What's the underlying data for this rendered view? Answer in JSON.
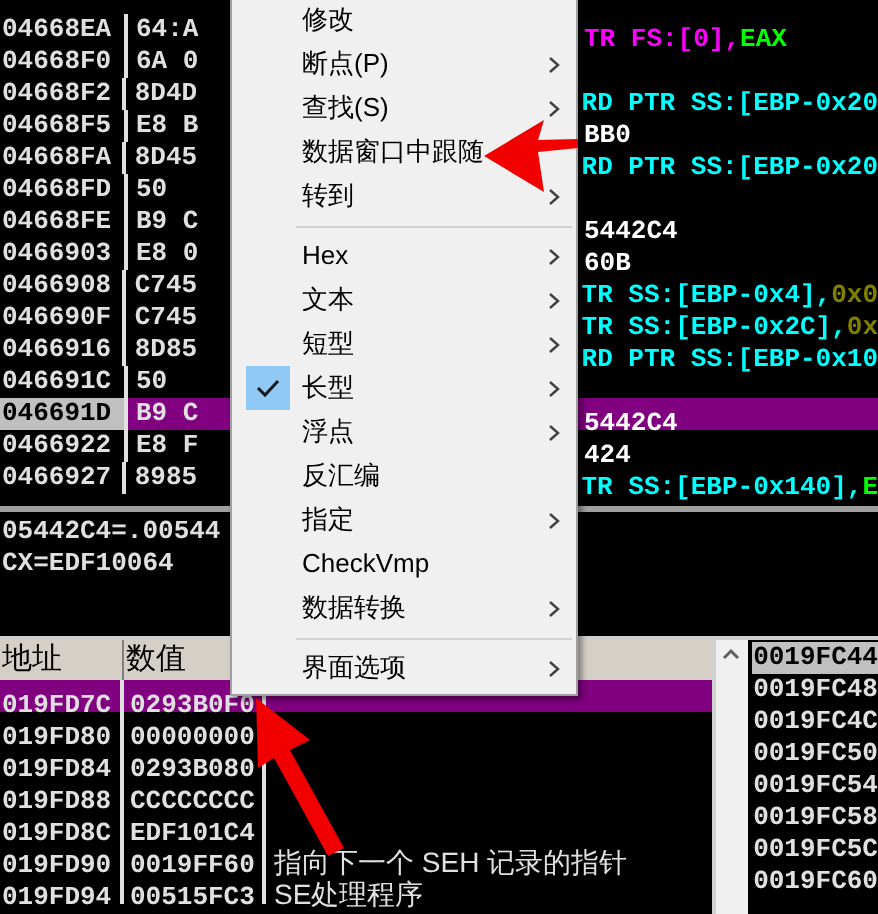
{
  "disassembly": {
    "rows": [
      {
        "address": "04668EA",
        "bytes": "64:A",
        "selected": false,
        "operand": [
          {
            "text": "TR FS:[",
            "color": "#ff00ff"
          },
          {
            "text": "0",
            "color": "#ff00ff"
          },
          {
            "text": "],",
            "color": "#ff00ff"
          },
          {
            "text": "EAX",
            "color": "#00ff00"
          }
        ]
      },
      {
        "address": "04668F0",
        "bytes": "6A 0",
        "selected": false,
        "operand": []
      },
      {
        "address": "04668F2",
        "bytes": "8D4D",
        "selected": false,
        "operand": [
          {
            "text": "RD PTR SS:[EBP-0x20",
            "color": "#00ffff"
          }
        ]
      },
      {
        "address": "04668F5",
        "bytes": "E8 B",
        "selected": false,
        "operand": [
          {
            "text": "BB0",
            "color": "#ffffff"
          }
        ]
      },
      {
        "address": "04668FA",
        "bytes": "8D45",
        "selected": false,
        "operand": [
          {
            "text": "RD PTR SS:[EBP-0x20",
            "color": "#00ffff"
          }
        ]
      },
      {
        "address": "04668FD",
        "bytes": "50",
        "selected": false,
        "operand": []
      },
      {
        "address": "04668FE",
        "bytes": "B9 C",
        "selected": false,
        "operand": [
          {
            "text": "5442C4",
            "color": "#ffffff"
          }
        ]
      },
      {
        "address": "0466903",
        "bytes": "E8 0",
        "selected": false,
        "operand": [
          {
            "text": "60B",
            "color": "#ffffff"
          }
        ]
      },
      {
        "address": "0466908",
        "bytes": "C745",
        "selected": false,
        "operand": [
          {
            "text": "TR SS:[EBP-0x4],",
            "color": "#00ffff"
          },
          {
            "text": "0x0",
            "color": "#808000"
          }
        ]
      },
      {
        "address": "046690F",
        "bytes": "C745",
        "selected": false,
        "operand": [
          {
            "text": "TR SS:[EBP-0x2C],",
            "color": "#00ffff"
          },
          {
            "text": "0x",
            "color": "#808000"
          }
        ]
      },
      {
        "address": "0466916",
        "bytes": "8D85",
        "selected": false,
        "operand": [
          {
            "text": "RD PTR SS:[EBP-0x10",
            "color": "#00ffff"
          }
        ]
      },
      {
        "address": "046691C",
        "bytes": "50",
        "selected": false,
        "operand": []
      },
      {
        "address": "046691D",
        "bytes": "B9 C",
        "selected": true,
        "operand": [
          {
            "text": "5442C4",
            "color": "#ffffff"
          }
        ]
      },
      {
        "address": "0466922",
        "bytes": "E8 F",
        "selected": false,
        "operand": [
          {
            "text": "424",
            "color": "#ffffff"
          }
        ]
      },
      {
        "address": "0466927",
        "bytes": "8985",
        "selected": false,
        "operand": [
          {
            "text": "TR SS:[EBP-0x140],",
            "color": "#00ffff"
          },
          {
            "text": "E",
            "color": "#00ff00"
          }
        ]
      }
    ]
  },
  "info": [
    "05442C4=.00544",
    "CX=EDF10064"
  ],
  "stack": {
    "columns": [
      "地址",
      "数值"
    ],
    "rows": [
      {
        "address": "019FD7C",
        "value": "0293B0F0",
        "comment": "",
        "selected": true
      },
      {
        "address": "019FD80",
        "value": "00000000",
        "comment": "",
        "selected": false
      },
      {
        "address": "019FD84",
        "value": "0293B080",
        "comment": "",
        "selected": false
      },
      {
        "address": "019FD88",
        "value": "CCCCCCCC",
        "comment": "",
        "selected": false
      },
      {
        "address": "019FD8C",
        "value": "EDF101C4",
        "comment": "",
        "selected": false
      },
      {
        "address": "019FD90",
        "value": "0019FF60",
        "comment": "指向下一个 SEH 记录的指针",
        "selected": false
      },
      {
        "address": "019FD94",
        "value": "00515FC3",
        "comment": "SE处理程序",
        "selected": false
      }
    ]
  },
  "side_stack": [
    {
      "address": "0019FC44",
      "selected": true
    },
    {
      "address": "0019FC48",
      "selected": false
    },
    {
      "address": "0019FC4C",
      "selected": false
    },
    {
      "address": "0019FC50",
      "selected": false
    },
    {
      "address": "0019FC54",
      "selected": false
    },
    {
      "address": "0019FC58",
      "selected": false
    },
    {
      "address": "0019FC5C",
      "selected": false
    },
    {
      "address": "0019FC60",
      "selected": false
    }
  ],
  "context_menu": {
    "groups": [
      [
        {
          "label": "修改",
          "submenu": false,
          "checked": false
        },
        {
          "label": "断点(P)",
          "submenu": true,
          "checked": false
        },
        {
          "label": "查找(S)",
          "submenu": true,
          "checked": false
        },
        {
          "label": "数据窗口中跟随",
          "submenu": false,
          "checked": false
        },
        {
          "label": "转到",
          "submenu": true,
          "checked": false
        }
      ],
      [
        {
          "label": "Hex",
          "submenu": true,
          "checked": false
        },
        {
          "label": "文本",
          "submenu": true,
          "checked": false
        },
        {
          "label": "短型",
          "submenu": true,
          "checked": false
        },
        {
          "label": "长型",
          "submenu": true,
          "checked": true
        },
        {
          "label": "浮点",
          "submenu": true,
          "checked": false
        },
        {
          "label": "反汇编",
          "submenu": false,
          "checked": false
        },
        {
          "label": "指定",
          "submenu": true,
          "checked": false
        },
        {
          "label": "CheckVmp",
          "submenu": false,
          "checked": false
        },
        {
          "label": "数据转换",
          "submenu": true,
          "checked": false
        }
      ],
      [
        {
          "label": "界面选项",
          "submenu": true,
          "checked": false
        }
      ]
    ]
  }
}
